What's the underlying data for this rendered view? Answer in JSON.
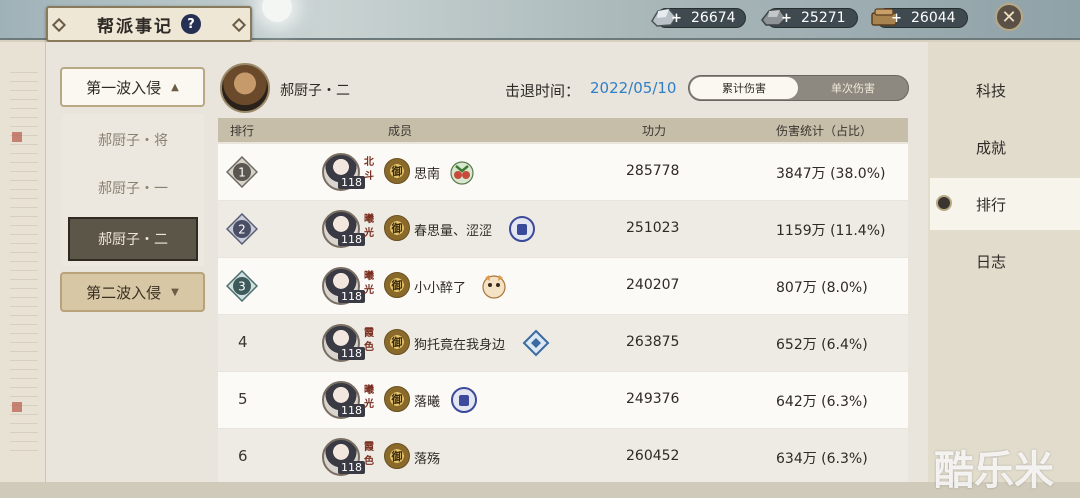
{
  "header": {
    "title": "帮派事记",
    "help_label": "?",
    "resources": [
      {
        "icon": "silver-ore-icon",
        "value": "26674"
      },
      {
        "icon": "iron-ore-icon",
        "value": "25271"
      },
      {
        "icon": "wood-icon",
        "value": "26044"
      }
    ]
  },
  "waves": {
    "wave1": {
      "label": "第一波入侵",
      "caret": "▲"
    },
    "wave1_items": [
      "郝厨子・将",
      "郝厨子・一",
      "郝厨子・二"
    ],
    "wave2": {
      "label": "第二波入侵",
      "caret": "▼"
    }
  },
  "boss": {
    "name": "郝厨子・二"
  },
  "repel": {
    "label": "击退时间：",
    "date": "2022/05/10"
  },
  "toggle": {
    "cumulative": "累计伤害",
    "single": "单次伤害"
  },
  "table": {
    "headers": {
      "rank": "排行",
      "member": "成员",
      "power": "功力",
      "damage": "伤害统计（占比）"
    },
    "rows": [
      {
        "rank": "1",
        "title": "北斗",
        "guard": "御",
        "level": "118",
        "name": "思南",
        "power": "285778",
        "damage": "3847万 (38.0%)"
      },
      {
        "rank": "2",
        "title": "曦光",
        "guard": "御",
        "level": "118",
        "name": "春思量、涩涩",
        "power": "251023",
        "damage": "1159万 (11.4%)"
      },
      {
        "rank": "3",
        "title": "曦光",
        "guard": "御",
        "level": "118",
        "name": "小小醉了",
        "power": "240207",
        "damage": "807万 (8.0%)"
      },
      {
        "rank": "4",
        "title": "霞色",
        "guard": "御",
        "level": "118",
        "name": "狗托竟在我身边",
        "power": "263875",
        "damage": "652万 (6.4%)"
      },
      {
        "rank": "5",
        "title": "曦光",
        "guard": "御",
        "level": "118",
        "name": "落曦",
        "power": "249376",
        "damage": "642万 (6.3%)"
      },
      {
        "rank": "6",
        "title": "霞色",
        "guard": "御",
        "level": "118",
        "name": "落殇",
        "power": "260452",
        "damage": "634万 (6.3%)"
      }
    ]
  },
  "nav": [
    "科技",
    "成就",
    "排行",
    "日志"
  ],
  "watermark": "酷乐米"
}
